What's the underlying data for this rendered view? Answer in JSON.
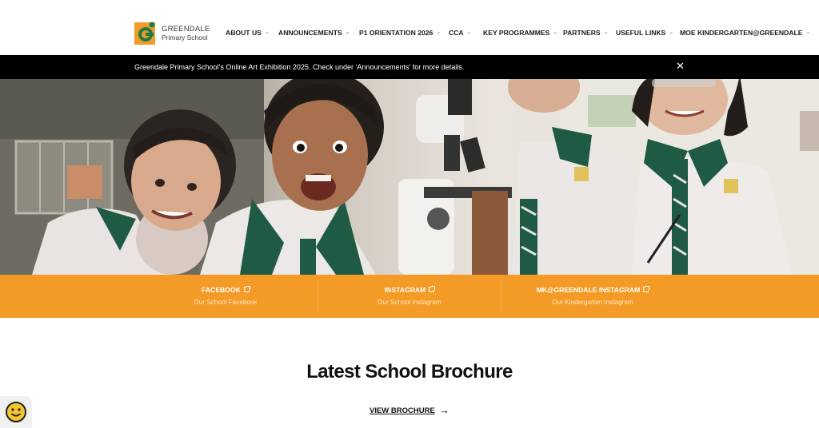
{
  "header": {
    "logo": {
      "line1": "GREENDALE",
      "line2": "Primary School"
    },
    "nav": [
      {
        "label": "ABOUT US"
      },
      {
        "label": "ANNOUNCEMENTS"
      },
      {
        "label": "P1 ORIENTATION 2026"
      },
      {
        "label": "CCA"
      },
      {
        "label": "KEY PROGRAMMES"
      },
      {
        "label": "PARTNERS"
      },
      {
        "label": "USEFUL LINKS"
      },
      {
        "label": "MOE KINDERGARTEN@GREENDALE"
      }
    ]
  },
  "announcement": {
    "text": "Greendale Primary School’s Online Art Exhibition 2025. Check under ‘Announcements’ for more details.",
    "close_icon": "close-icon"
  },
  "social": [
    {
      "title": "FACEBOOK",
      "subtitle": "Our School Facebook"
    },
    {
      "title": "INSTAGRAM",
      "subtitle": "Our School Instagram"
    },
    {
      "title": "MK@GREENDALE INSTAGRAM",
      "subtitle": "Our Kindergarten Instagram"
    }
  ],
  "brochure": {
    "title": "Latest School Brochure",
    "link_label": "VIEW BROCHURE"
  },
  "colors": {
    "accent_orange": "#f49b27",
    "announce_bg": "#000000",
    "uniform_green": "#1f5a45"
  }
}
